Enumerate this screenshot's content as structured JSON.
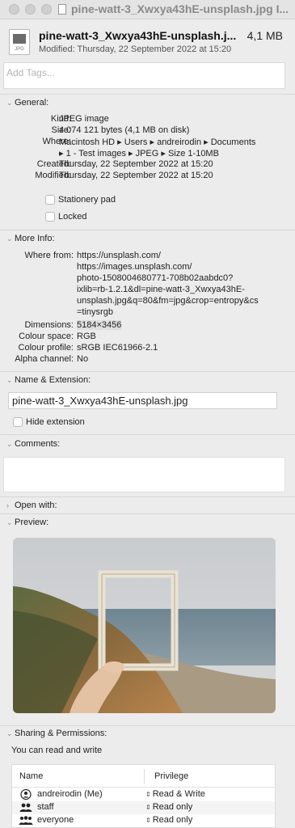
{
  "titlebar": {
    "title": "pine-watt-3_Xwxya43hE-unsplash.jpg I..."
  },
  "header": {
    "filename": "pine-watt-3_Xwxya43hE-unsplash.j...",
    "size": "4,1 MB",
    "modified": "Modified: Thursday, 22 September 2022 at 15:20",
    "icon_ext": "JPG"
  },
  "tags": {
    "placeholder": "Add Tags..."
  },
  "general": {
    "heading": "General:",
    "kind_label": "Kind:",
    "kind": "JPEG image",
    "size_label": "Size:",
    "size": "4 074 121 bytes (4,1 MB on disk)",
    "where_label": "Where:",
    "where_line1": "Macintosh HD ▸ Users ▸ andreirodin ▸ Documents",
    "where_line2": "▸ 1 - Test images ▸ JPEG ▸ Size 1-10MB",
    "created_label": "Created:",
    "created": "Thursday, 22 September 2022 at 15:20",
    "modified_label": "Modified:",
    "modified": "Thursday, 22 September 2022 at 15:20",
    "stationery": "Stationery pad",
    "locked": "Locked"
  },
  "more_info": {
    "heading": "More Info:",
    "where_from_label": "Where from:",
    "where_from_lines": [
      "https://unsplash.com/",
      "https://images.unsplash.com/",
      "photo-1508004680771-708b02aabdc0?",
      "ixlib=rb-1.2.1&dl=pine-watt-3_Xwxya43hE-",
      "unsplash.jpg&q=80&fm=jpg&crop=entropy&cs",
      "=tinysrgb"
    ],
    "dimensions_label": "Dimensions:",
    "dimensions": "5184×3456",
    "colour_space_label": "Colour space:",
    "colour_space": "RGB",
    "colour_profile_label": "Colour profile:",
    "colour_profile": "sRGB IEC61966-2.1",
    "alpha_label": "Alpha channel:",
    "alpha": "No"
  },
  "name_ext": {
    "heading": "Name & Extension:",
    "value": "pine-watt-3_Xwxya43hE-unsplash.jpg",
    "hide_extension": "Hide extension"
  },
  "comments": {
    "heading": "Comments:"
  },
  "open_with": {
    "heading": "Open with:"
  },
  "preview": {
    "heading": "Preview:"
  },
  "sharing": {
    "heading": "Sharing & Permissions:",
    "summary": "You can read and write",
    "col_name": "Name",
    "col_privilege": "Privilege",
    "rows": [
      {
        "name": "andreirodin (Me)",
        "privilege": "Read & Write",
        "icon": "person-icon"
      },
      {
        "name": "staff",
        "privilege": "Read only",
        "icon": "group-icon"
      },
      {
        "name": "everyone",
        "privilege": "Read only",
        "icon": "everyone-icon"
      }
    ]
  }
}
